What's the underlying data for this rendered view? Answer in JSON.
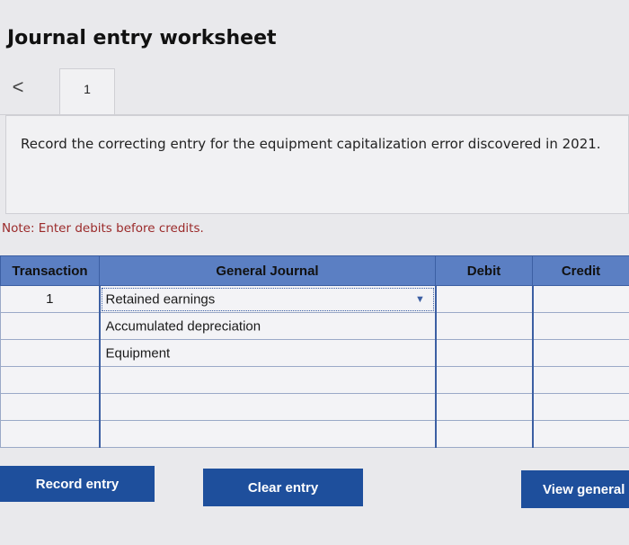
{
  "header": {
    "title": "Journal entry worksheet"
  },
  "tabs": {
    "prev_symbol": "<",
    "current_label": "1"
  },
  "prompt": {
    "text": "Record the correcting entry for the equipment capitalization error discovered in 2021."
  },
  "note": "Note: Enter debits before credits.",
  "table": {
    "headers": {
      "transaction": "Transaction",
      "journal": "General Journal",
      "debit": "Debit",
      "credit": "Credit"
    },
    "rows": [
      {
        "transaction": "1",
        "account": "Retained earnings",
        "debit": "",
        "credit": ""
      },
      {
        "transaction": "",
        "account": "Accumulated depreciation",
        "debit": "",
        "credit": ""
      },
      {
        "transaction": "",
        "account": "Equipment",
        "debit": "",
        "credit": ""
      },
      {
        "transaction": "",
        "account": "",
        "debit": "",
        "credit": ""
      },
      {
        "transaction": "",
        "account": "",
        "debit": "",
        "credit": ""
      },
      {
        "transaction": "",
        "account": "",
        "debit": "",
        "credit": ""
      }
    ]
  },
  "buttons": {
    "record": "Record entry",
    "clear": "Clear entry",
    "view": "View general"
  },
  "colors": {
    "header_bg": "#5b7fc3",
    "button_bg": "#1e4f9c",
    "note_text": "#9b2a2a"
  }
}
